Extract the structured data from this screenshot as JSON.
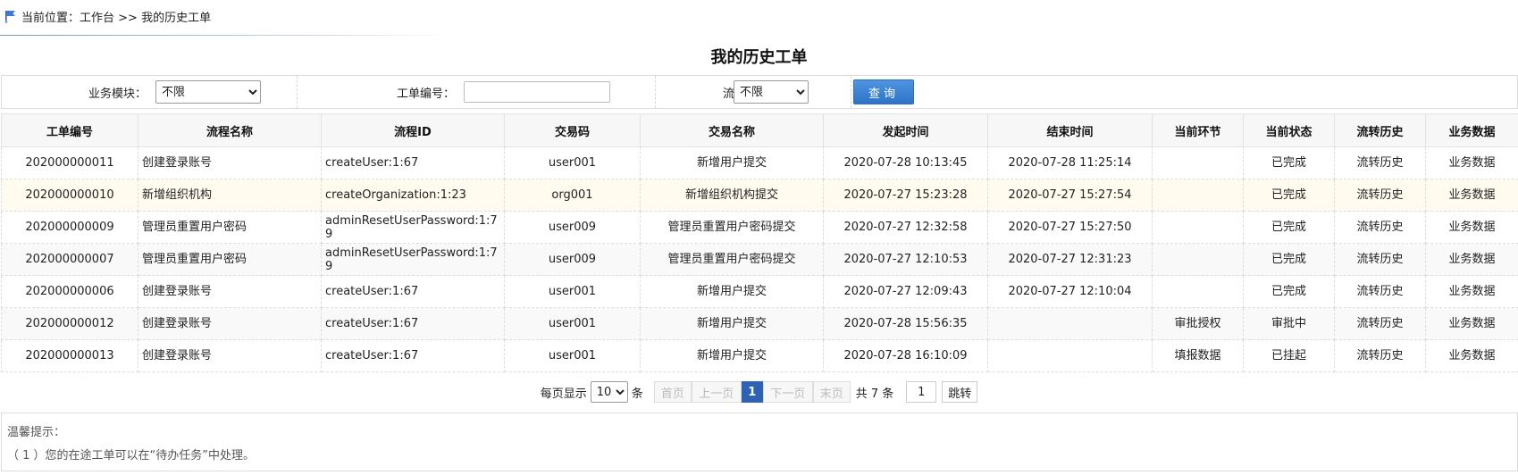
{
  "breadcrumb": {
    "prefix": "当前位置：",
    "path": "工作台 >> 我的历史工单"
  },
  "page_title": "我的历史工单",
  "filters": {
    "module_label": "业务模块：",
    "module_value": "不限",
    "ticket_label": "工单编号：",
    "ticket_value": "",
    "status_label": "流程状态：",
    "status_value": "不限",
    "query_button": "查询"
  },
  "table": {
    "headers": [
      "工单编号",
      "流程名称",
      "流程ID",
      "交易码",
      "交易名称",
      "发起时间",
      "结束时间",
      "当前环节",
      "当前状态",
      "流转历史",
      "业务数据"
    ],
    "rows": [
      {
        "id": "202000000011",
        "flow": "创建登录账号",
        "flow_id": "createUser:1:67",
        "code": "user001",
        "tx": "新增用户提交",
        "start": "2020-07-28 10:13:45",
        "end": "2020-07-28 11:25:14",
        "node": "",
        "status": "已完成",
        "history": "流转历史",
        "biz": "业务数据"
      },
      {
        "id": "202000000010",
        "flow": "新增组织机构",
        "flow_id": "createOrganization:1:23",
        "code": "org001",
        "tx": "新增组织机构提交",
        "start": "2020-07-27 15:23:28",
        "end": "2020-07-27 15:27:54",
        "node": "",
        "status": "已完成",
        "history": "流转历史",
        "biz": "业务数据"
      },
      {
        "id": "202000000009",
        "flow": "管理员重置用户密码",
        "flow_id": "adminResetUserPassword:1:79",
        "code": "user009",
        "tx": "管理员重置用户密码提交",
        "start": "2020-07-27 12:32:58",
        "end": "2020-07-27 15:27:50",
        "node": "",
        "status": "已完成",
        "history": "流转历史",
        "biz": "业务数据"
      },
      {
        "id": "202000000007",
        "flow": "管理员重置用户密码",
        "flow_id": "adminResetUserPassword:1:79",
        "code": "user009",
        "tx": "管理员重置用户密码提交",
        "start": "2020-07-27 12:10:53",
        "end": "2020-07-27 12:31:23",
        "node": "",
        "status": "已完成",
        "history": "流转历史",
        "biz": "业务数据"
      },
      {
        "id": "202000000006",
        "flow": "创建登录账号",
        "flow_id": "createUser:1:67",
        "code": "user001",
        "tx": "新增用户提交",
        "start": "2020-07-27 12:09:43",
        "end": "2020-07-27 12:10:04",
        "node": "",
        "status": "已完成",
        "history": "流转历史",
        "biz": "业务数据"
      },
      {
        "id": "202000000012",
        "flow": "创建登录账号",
        "flow_id": "createUser:1:67",
        "code": "user001",
        "tx": "新增用户提交",
        "start": "2020-07-28 15:56:35",
        "end": "",
        "node": "审批授权",
        "status": "审批中",
        "history": "流转历史",
        "biz": "业务数据"
      },
      {
        "id": "202000000013",
        "flow": "创建登录账号",
        "flow_id": "createUser:1:67",
        "code": "user001",
        "tx": "新增用户提交",
        "start": "2020-07-28 16:10:09",
        "end": "",
        "node": "填报数据",
        "status": "已挂起",
        "history": "流转历史",
        "biz": "业务数据"
      }
    ]
  },
  "status_colors": {
    "已完成": "#2aa52a",
    "审批中": "#e08a00",
    "已挂起": "#e23030"
  },
  "pager": {
    "per_page_label": "每页显示",
    "per_page_value": "10",
    "per_page_unit": "条",
    "first": "首页",
    "prev": "上一页",
    "current": "1",
    "next": "下一页",
    "last": "末页",
    "total": "共 7 条",
    "goto_value": "1",
    "goto_button": "跳转"
  },
  "tips": {
    "title": "温馨提示：",
    "line1": "（ 1 ）您的在途工单可以在“待办任务”中处理。"
  }
}
